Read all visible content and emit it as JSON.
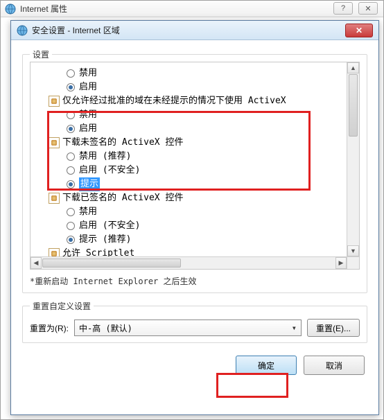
{
  "parent": {
    "title": "Internet 属性",
    "help_icon": "?",
    "close_icon": "✕"
  },
  "child": {
    "title": "安全设置 - Internet 区域",
    "close_icon": "✕"
  },
  "settings": {
    "label": "设置",
    "restart_note": "*重新启动 Internet Explorer 之后生效",
    "tree": [
      {
        "type": "radio",
        "level": 2,
        "checked": false,
        "label": "禁用"
      },
      {
        "type": "radio",
        "level": 2,
        "checked": true,
        "label": "启用"
      },
      {
        "type": "category",
        "level": 1,
        "label": "仅允许经过批准的域在未经提示的情况下使用 ActiveX"
      },
      {
        "type": "radio",
        "level": 2,
        "checked": false,
        "label": "禁用"
      },
      {
        "type": "radio",
        "level": 2,
        "checked": true,
        "label": "启用"
      },
      {
        "type": "category",
        "level": 1,
        "label": "下载未签名的 ActiveX 控件"
      },
      {
        "type": "radio",
        "level": 2,
        "checked": false,
        "label": "禁用 (推荐)"
      },
      {
        "type": "radio",
        "level": 2,
        "checked": false,
        "label": "启用 (不安全)"
      },
      {
        "type": "radio",
        "level": 2,
        "checked": true,
        "label": "提示",
        "selected": true
      },
      {
        "type": "category",
        "level": 1,
        "label": "下载已签名的 ActiveX 控件"
      },
      {
        "type": "radio",
        "level": 2,
        "checked": false,
        "label": "禁用"
      },
      {
        "type": "radio",
        "level": 2,
        "checked": false,
        "label": "启用 (不安全)"
      },
      {
        "type": "radio",
        "level": 2,
        "checked": true,
        "label": "提示 (推荐)"
      },
      {
        "type": "category",
        "level": 1,
        "label": "允许 Scriptlet"
      }
    ]
  },
  "reset": {
    "group_label": "重置自定义设置",
    "label": "重置为(R):",
    "combo_value": "中-高 (默认)",
    "button": "重置(E)..."
  },
  "buttons": {
    "ok": "确定",
    "cancel": "取消"
  }
}
